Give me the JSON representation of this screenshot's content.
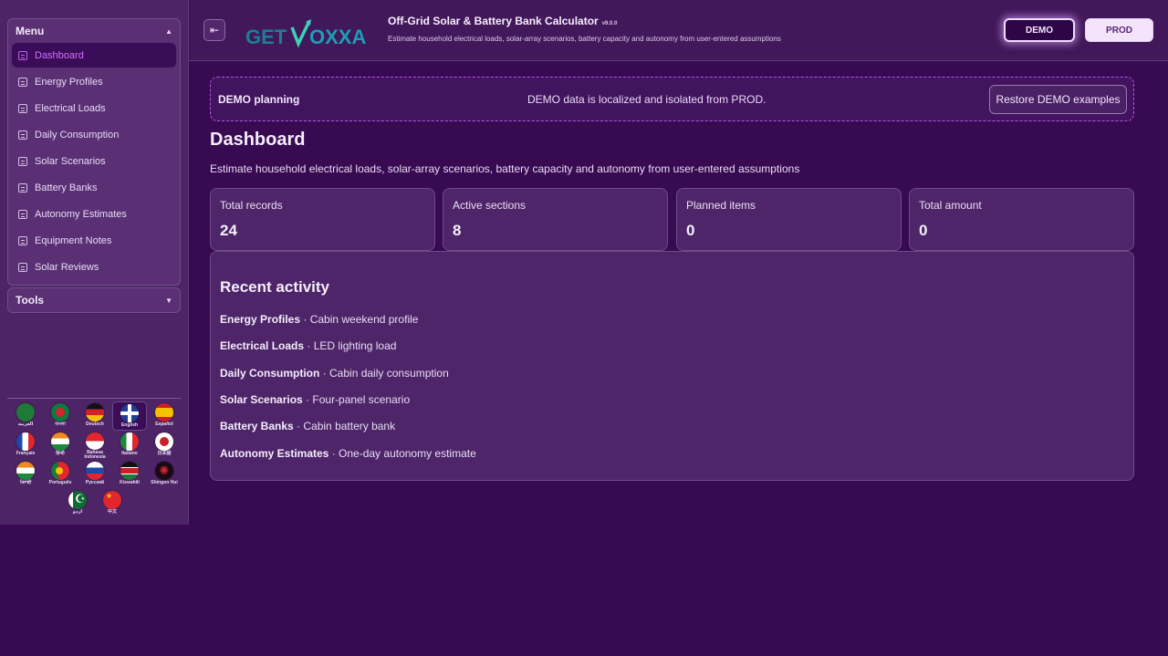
{
  "sidebar": {
    "menu_title": "Menu",
    "menu_items": [
      {
        "label": "Dashboard",
        "active": true
      },
      {
        "label": "Energy Profiles"
      },
      {
        "label": "Electrical Loads"
      },
      {
        "label": "Daily Consumption"
      },
      {
        "label": "Solar Scenarios"
      },
      {
        "label": "Battery Banks"
      },
      {
        "label": "Autonomy Estimates"
      },
      {
        "label": "Equipment Notes"
      },
      {
        "label": "Solar Reviews"
      }
    ],
    "tools_title": "Tools",
    "languages": [
      {
        "label": "العربية",
        "flag": "f-ar"
      },
      {
        "label": "বাংলা",
        "flag": "f-bn"
      },
      {
        "label": "Deutsch",
        "flag": "f-de"
      },
      {
        "label": "English",
        "flag": "f-en",
        "active": true
      },
      {
        "label": "Español",
        "flag": "f-es"
      },
      {
        "label": "Français",
        "flag": "f-fr"
      },
      {
        "label": "हिन्दी",
        "flag": "f-hi"
      },
      {
        "label": "Bahasa Indonesia",
        "flag": "f-id"
      },
      {
        "label": "Italiano",
        "flag": "f-it"
      },
      {
        "label": "日本語",
        "flag": "f-ja"
      },
      {
        "label": "ਪੰਜਾਬੀ",
        "flag": "f-pa"
      },
      {
        "label": "Português",
        "flag": "f-pt"
      },
      {
        "label": "Русский",
        "flag": "f-ru"
      },
      {
        "label": "Kiswahili",
        "flag": "f-sw"
      },
      {
        "label": "Shingon Hui",
        "flag": "f-sh"
      },
      {
        "label": "اردو",
        "flag": "f-ur"
      },
      {
        "label": "中文",
        "flag": "f-zh"
      }
    ]
  },
  "header": {
    "logo_text_left": "GET",
    "logo_text_right": "OXXA",
    "title": "Off-Grid Solar & Battery Bank Calculator",
    "version": "v9.0.0",
    "subtitle": "Estimate household electrical loads, solar-array scenarios, battery capacity and autonomy from user-entered assumptions",
    "demo_label": "DEMO",
    "prod_label": "PROD"
  },
  "banner": {
    "title": "DEMO planning",
    "text": "DEMO data is localized and isolated from PROD.",
    "restore_label": "Restore DEMO examples"
  },
  "main": {
    "title": "Dashboard",
    "subtitle": "Estimate household electrical loads, solar-array scenarios, battery capacity and autonomy from user-entered assumptions",
    "stats": [
      {
        "label": "Total records",
        "value": "24"
      },
      {
        "label": "Active sections",
        "value": "8"
      },
      {
        "label": "Planned items",
        "value": "0"
      },
      {
        "label": "Total amount",
        "value": "0"
      }
    ],
    "activity_title": "Recent activity",
    "activity": [
      {
        "section": "Energy Profiles",
        "item": "Cabin weekend profile"
      },
      {
        "section": "Electrical Loads",
        "item": "LED lighting load"
      },
      {
        "section": "Daily Consumption",
        "item": "Cabin daily consumption"
      },
      {
        "section": "Solar Scenarios",
        "item": "Four-panel scenario"
      },
      {
        "section": "Battery Banks",
        "item": "Cabin battery bank"
      },
      {
        "section": "Autonomy Estimates",
        "item": "One-day autonomy estimate"
      }
    ]
  },
  "colors": {
    "background": "#370a51",
    "accent": "#d071ff",
    "card": "#4d2568"
  }
}
